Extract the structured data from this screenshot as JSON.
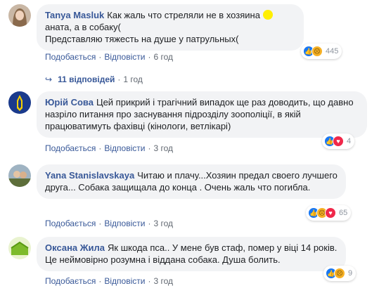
{
  "comments": [
    {
      "author": "Tanya Masluk",
      "text_a": "Как жаль что стреляли не в хозяина ",
      "text_b": "аната, а в собаку(",
      "text_c": "Представляю тяжесть на душе у патрульных(",
      "like": "Подобається",
      "reply": "Відповісти",
      "time": "6 год",
      "reactions": [
        "like-icon",
        "sad-icon"
      ],
      "count": "445"
    },
    {
      "author": "Юрій Сова",
      "text": "Цей прикрий і трагічний випадок ще раз доводить, що давно назріло питання про заснування підрозділу зоополіції, в якій працюватимуть фахівці (кінологи, ветлікарі)",
      "like": "Подобається",
      "reply": "Відповісти",
      "time": "3 год",
      "reactions": [
        "like-icon",
        "love-icon"
      ],
      "count": "4"
    },
    {
      "author": "Yana Stanislavskaya",
      "text": "Читаю и плачу...Хозяин предал своего лучшего друга... Собака защищала до конца . Очень жаль что погибла.",
      "like": "Подобається",
      "reply": "Відповісти",
      "time": "3 год",
      "reactions": [
        "like-icon",
        "sad-icon",
        "love-icon"
      ],
      "count": "65"
    },
    {
      "author": "Оксана Жила",
      "text": "Як шкода пса.. У мене був стаф, помер у віці 14 років. Це неймовірно розумна і віддана собака. Душа болить.",
      "like": "Подобається",
      "reply": "Відповісти",
      "time": "3 год",
      "reactions": [
        "like-icon",
        "sad-icon"
      ],
      "count": "9"
    }
  ],
  "replies": {
    "arrow": "↪",
    "label": "11 відповідей",
    "sep": "·",
    "time": "1 год"
  },
  "separator": "·",
  "colors": {
    "link": "#385898",
    "bubble": "#f2f3f5",
    "like": "#1877f2",
    "sad": "#f7b125",
    "love": "#f0284a"
  }
}
